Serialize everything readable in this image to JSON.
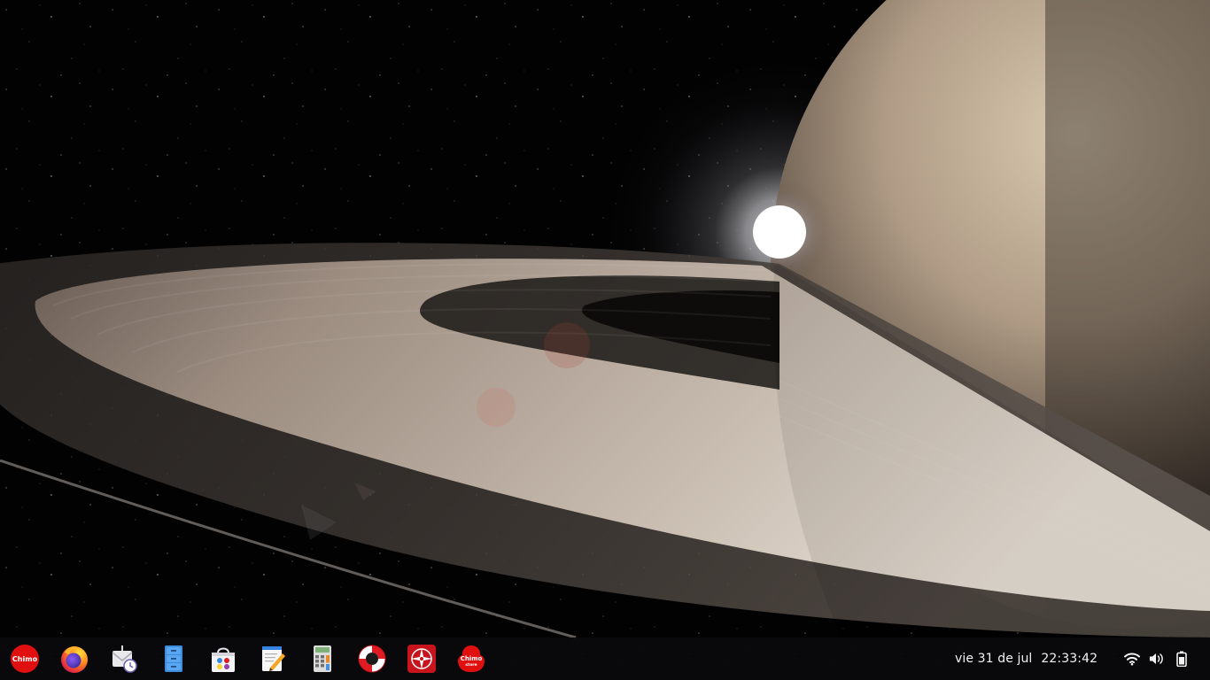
{
  "desktop": {
    "wallpaper": "Saturn rings with sunrise over planet"
  },
  "taskbar": {
    "apps": [
      {
        "name": "Chimo menu",
        "label": "Chimo",
        "icon": "chimo-logo-icon"
      },
      {
        "name": "Firefox",
        "icon": "firefox-icon"
      },
      {
        "name": "Mail reminder",
        "icon": "mail-clock-icon"
      },
      {
        "name": "File manager",
        "icon": "file-cabinet-icon"
      },
      {
        "name": "Software store",
        "icon": "shopping-bag-icon"
      },
      {
        "name": "Text editor",
        "icon": "text-editor-icon"
      },
      {
        "name": "Calculator",
        "icon": "calculator-icon"
      },
      {
        "name": "Help",
        "icon": "lifebuoy-icon"
      },
      {
        "name": "Compass app",
        "icon": "compass-icon"
      },
      {
        "name": "Chimo store",
        "label": "Chimo",
        "sublabel": "store",
        "icon": "chimo-store-icon"
      }
    ],
    "clock": {
      "date": "vie 31 de jul",
      "time": "22:33:42"
    },
    "tray": [
      {
        "name": "wifi",
        "icon": "wifi-icon"
      },
      {
        "name": "volume",
        "icon": "volume-icon"
      },
      {
        "name": "battery",
        "icon": "battery-icon"
      }
    ]
  },
  "colors": {
    "taskbar_bg": "#0b0b0d",
    "chimo_red": "#e01010",
    "text": "#f2f2f2"
  }
}
